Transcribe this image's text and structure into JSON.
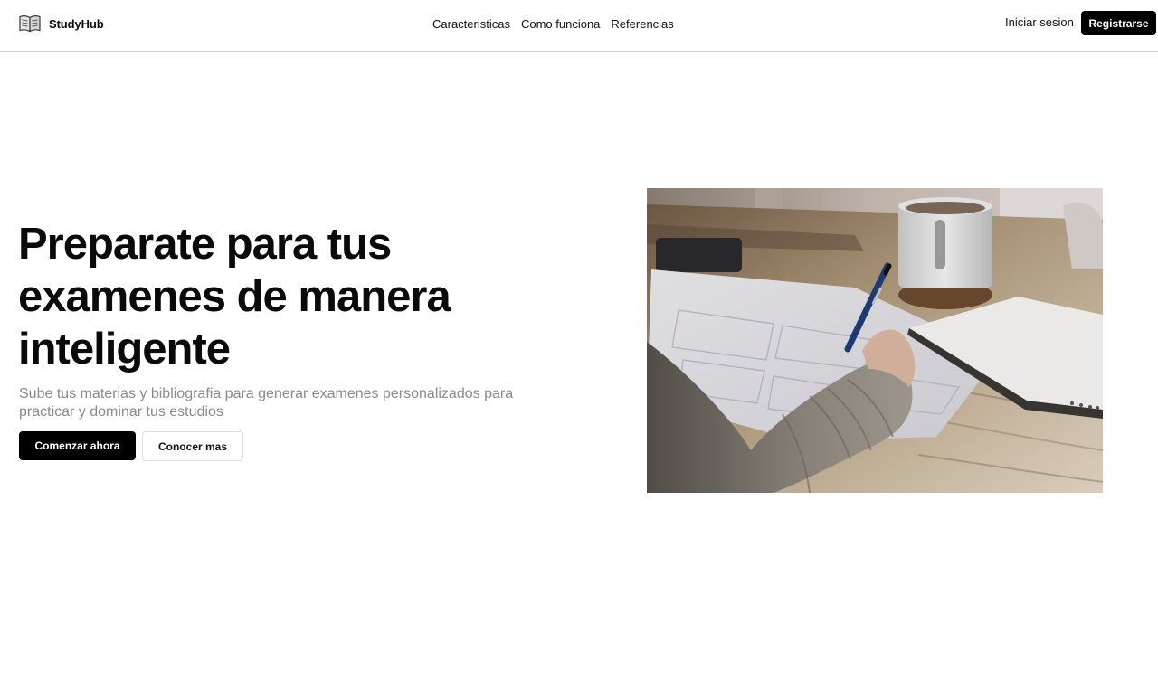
{
  "brand": {
    "name": "StudyHub",
    "icon": "book-icon"
  },
  "nav": {
    "links": [
      {
        "label": "Caracteristicas"
      },
      {
        "label": "Como funciona"
      },
      {
        "label": "Referencias"
      }
    ],
    "login_label": "Iniciar sesion",
    "register_label": "Registrarse"
  },
  "hero": {
    "title": "Preparate para tus examenes de manera inteligente",
    "subtitle": "Sube tus materias y bibliografia para generar examenes personalizados para practicar y dominar tus estudios",
    "primary_cta": "Comenzar ahora",
    "secondary_cta": "Conocer mas",
    "image": "photo-student-writing-on-notebook"
  },
  "colors": {
    "primary": "#000000",
    "text": "#0a0a0a",
    "muted": "#8a8a8a",
    "border": "#cfcfcf"
  }
}
